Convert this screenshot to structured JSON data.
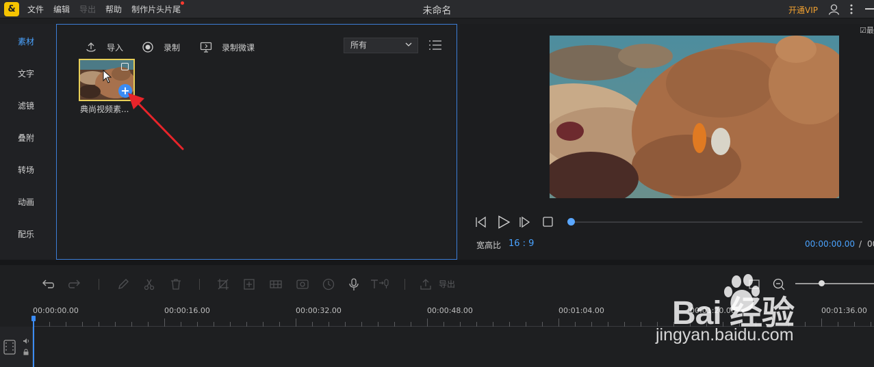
{
  "app": {
    "title": "未命名",
    "logo_glyph": "&",
    "vip_label": "开通VIP"
  },
  "menu": {
    "file": "文件",
    "edit": "编辑",
    "export": "导出",
    "help": "帮助",
    "intro_outro": "制作片头片尾"
  },
  "sidebar": {
    "items": [
      {
        "label": "素材",
        "active": true
      },
      {
        "label": "文字"
      },
      {
        "label": "滤镜"
      },
      {
        "label": "叠附"
      },
      {
        "label": "转场"
      },
      {
        "label": "动画"
      },
      {
        "label": "配乐"
      }
    ]
  },
  "media": {
    "import_label": "导入",
    "record_label": "录制",
    "record_lesson_label": "录制微课",
    "filter_selected": "所有",
    "item": {
      "label": "典尚视频素...",
      "add_glyph": "+"
    }
  },
  "preview": {
    "corner_label": "☑最",
    "ratio_label": "宽高比",
    "ratio_value": "16 : 9",
    "current_time": "00:00:00.00",
    "time_separator": "/",
    "total_time_partial": "00"
  },
  "timeline": {
    "export_label": "导出",
    "ticks": [
      "00:00:00.00",
      "00:00:16.00",
      "00:00:32.00",
      "00:00:48.00",
      "00:01:04.00",
      "00:01:20.00",
      "00:01:36.00"
    ]
  },
  "watermark": {
    "brand": "Bai 经验",
    "url": "jingyan.baidu.com"
  },
  "colors": {
    "accent": "#4aa3ff",
    "vip": "#f0a030",
    "selection_border": "#e8cf58",
    "panel_border": "#3d7ed8"
  }
}
